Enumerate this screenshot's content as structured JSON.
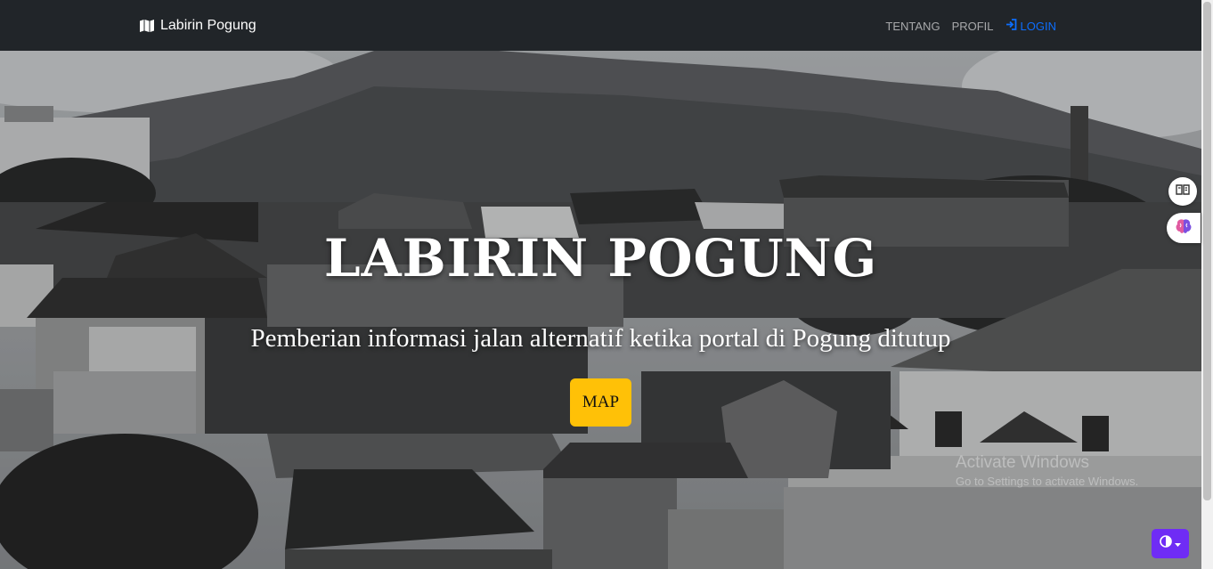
{
  "navbar": {
    "brand_label": "Labirin Pogung",
    "brand_icon": "map-icon",
    "links": [
      {
        "label": "TENTANG"
      },
      {
        "label": "PROFIL"
      },
      {
        "label": "LOGIN",
        "icon": "login-icon"
      }
    ]
  },
  "hero": {
    "title": "LABIRIN POGUNG",
    "subtitle": "Pemberian informasi jalan alternatif ketika portal di Pogung ditutup",
    "button_label": "MAP"
  },
  "floating": {
    "reader_icon": "book-reader-icon",
    "brain_icon": "brain-icon",
    "theme_icon": "contrast-icon"
  },
  "watermark": {
    "title": "Activate Windows",
    "subtitle": "Go to Settings to activate Windows."
  },
  "colors": {
    "navbar_bg": "#212529",
    "login_link": "#0d6efd",
    "map_button": "#ffc107",
    "theme_button": "#6f2cf5"
  }
}
